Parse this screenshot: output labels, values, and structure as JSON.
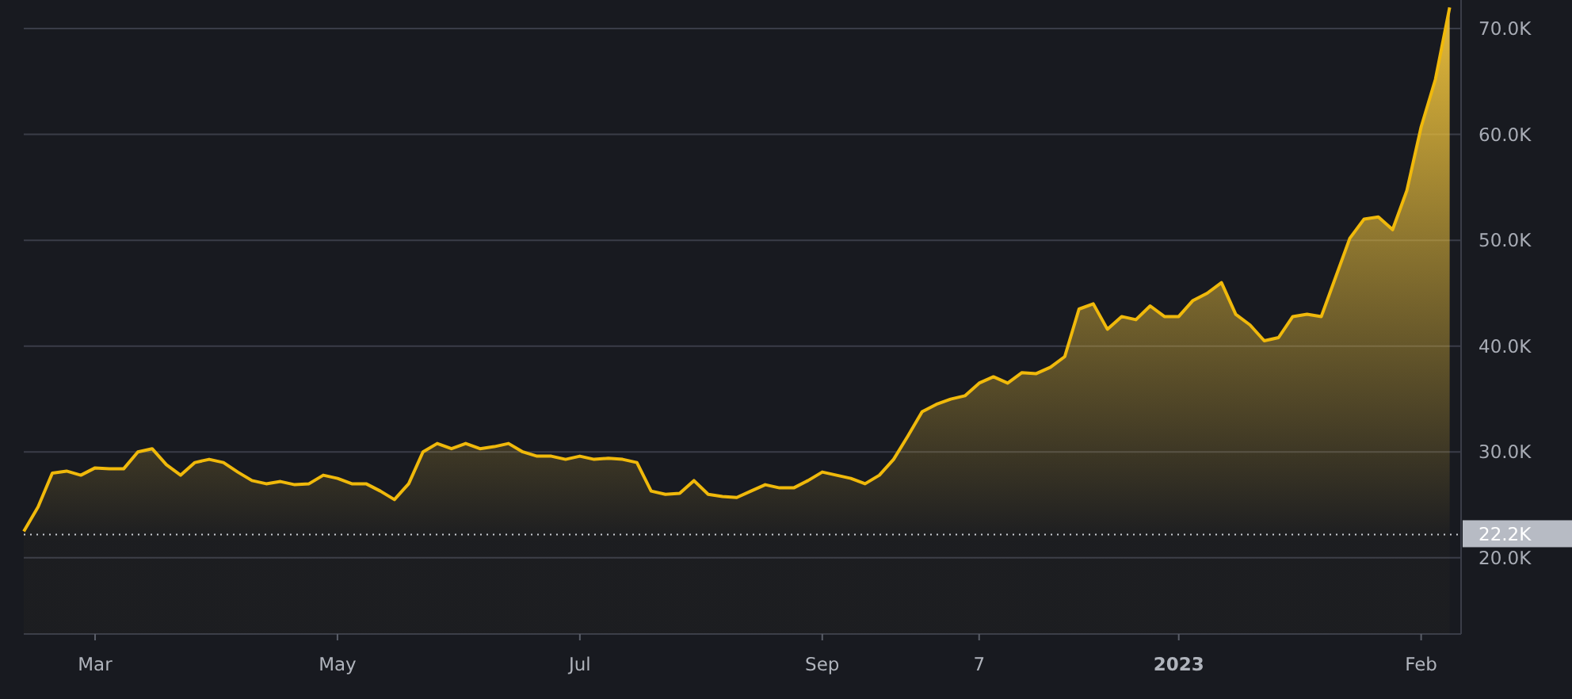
{
  "chart_data": {
    "type": "area",
    "categories": [
      null,
      null,
      null,
      null,
      null,
      "Mar",
      null,
      null,
      null,
      null,
      null,
      null,
      null,
      null,
      null,
      null,
      null,
      null,
      null,
      null,
      null,
      null,
      "May",
      null,
      null,
      null,
      null,
      null,
      null,
      null,
      null,
      null,
      null,
      null,
      null,
      null,
      null,
      null,
      null,
      "Jul",
      null,
      null,
      null,
      null,
      null,
      null,
      null,
      null,
      null,
      null,
      null,
      null,
      null,
      null,
      null,
      null,
      "Sep",
      null,
      null,
      null,
      null,
      null,
      null,
      null,
      null,
      null,
      null,
      "7",
      null,
      null,
      null,
      null,
      null,
      null,
      null,
      null,
      null,
      null,
      null,
      null,
      null,
      "2023",
      null,
      null,
      null,
      null,
      null,
      null,
      null,
      null,
      null,
      null,
      null,
      null,
      null,
      null,
      null,
      null,
      "Feb",
      null,
      null
    ],
    "series": [
      {
        "color": "#f0b90b",
        "values": [
          22.5,
          24.8,
          28,
          28.2,
          27.8,
          28.5,
          28.4,
          28.4,
          30,
          30.3,
          28.8,
          27.8,
          29,
          29.3,
          29,
          28.1,
          27.3,
          27,
          27.2,
          26.9,
          27,
          27.8,
          27.5,
          27,
          27,
          26.3,
          25.5,
          27,
          30,
          30.8,
          30.3,
          30.8,
          30.3,
          30.5,
          30.8,
          30,
          29.6,
          29.6,
          29.3,
          29.6,
          29.3,
          29.4,
          29.3,
          29,
          26.3,
          26,
          26.1,
          27.3,
          26,
          25.8,
          25.7,
          26.3,
          26.9,
          26.6,
          26.6,
          27.3,
          28.1,
          27.8,
          27.5,
          27,
          27.8,
          29.3,
          31.5,
          33.8,
          34.5,
          35,
          35.3,
          36.5,
          37.1,
          36.5,
          37.5,
          37.4,
          38,
          39,
          43.5,
          44,
          41.6,
          42.8,
          42.5,
          43.8,
          42.8,
          42.8,
          44.3,
          45,
          46,
          43,
          42,
          40.5,
          40.8,
          42.8,
          43,
          42.8,
          46.5,
          50.2,
          52,
          52.2,
          51,
          54.7,
          60.7,
          65.2,
          72
        ]
      }
    ],
    "ylim": [
      12.8,
      72.7
    ],
    "grid": true,
    "yticks": [
      {
        "value": 20,
        "label": "20.0K"
      },
      {
        "value": 30,
        "label": "30.0K"
      },
      {
        "value": 40,
        "label": "40.0K"
      },
      {
        "value": 50,
        "label": "50.0K"
      },
      {
        "value": 60,
        "label": "60.0K"
      },
      {
        "value": 70,
        "label": "70.0K"
      }
    ],
    "ref_lines": [
      {
        "axis": "y",
        "value": 22.2,
        "label": "22.2K"
      }
    ]
  }
}
